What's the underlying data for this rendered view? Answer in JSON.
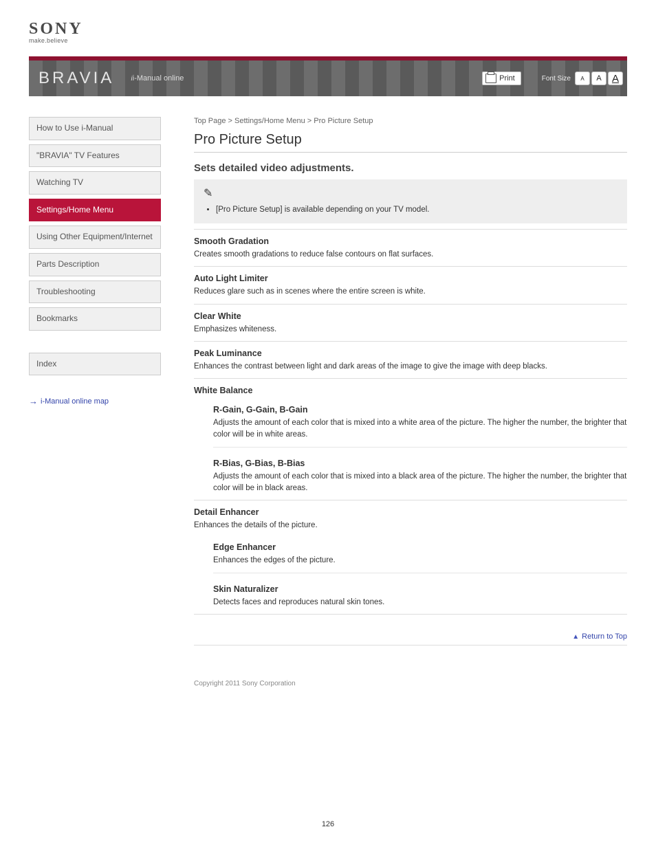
{
  "logo": {
    "brand": "SONY",
    "tagline": "make.believe"
  },
  "banner": {
    "title": "BRAVIA",
    "manual_label": "i-Manual online",
    "print_label": "Print",
    "font_size_label": "Font Size",
    "font_a": "A"
  },
  "sidebar": {
    "items": [
      {
        "label": "How to Use i-Manual"
      },
      {
        "label": "\"BRAVIA\" TV Features"
      },
      {
        "label": "Watching TV"
      },
      {
        "label": "Settings/Home Menu"
      },
      {
        "label": "Using Other Equipment/Internet"
      },
      {
        "label": "Parts Description"
      },
      {
        "label": "Troubleshooting"
      },
      {
        "label": "Bookmarks"
      },
      {
        "label": "Index"
      }
    ],
    "active_index": 3,
    "imanual_link": "i-Manual online map"
  },
  "main": {
    "breadcrumb": "Top Page > Settings/Home Menu > Pro Picture Setup",
    "title": "Pro Picture Setup",
    "lead": "Sets detailed video adjustments.",
    "note": "[Pro Picture Setup] is available depending on your TV model.",
    "sections": [
      {
        "title": "Smooth Gradation",
        "desc": "Creates smooth gradations to reduce false contours on flat surfaces."
      },
      {
        "title": "Auto Light Limiter",
        "desc": "Reduces glare such as in scenes where the entire screen is white."
      },
      {
        "title": "Clear White",
        "desc": "Emphasizes whiteness."
      },
      {
        "title": "Peak Luminance",
        "desc": "Enhances the contrast between light and dark areas of the image to give the image with deep blacks."
      }
    ],
    "white_balance_title": "White Balance",
    "white_balance": [
      {
        "title": "R-Gain, G-Gain, B-Gain",
        "desc": "Adjusts the amount of each color that is mixed into a white area of the picture. The higher the number, the brighter that color will be in white areas."
      },
      {
        "title": "R-Bias, G-Bias, B-Bias",
        "desc": "Adjusts the amount of each color that is mixed into a black area of the picture. The higher the number, the brighter that color will be in black areas."
      }
    ],
    "detail_title": "Detail Enhancer",
    "detail_desc": "Enhances the details of the picture.",
    "detail_sub": [
      {
        "title": "Edge Enhancer",
        "desc": "Enhances the edges of the picture."
      },
      {
        "title": "Skin Naturalizer",
        "desc": "Detects faces and reproduces natural skin tones."
      }
    ],
    "back_to_top": "Return to Top",
    "copyright": "Copyright 2011 Sony Corporation"
  },
  "page_number": "126"
}
